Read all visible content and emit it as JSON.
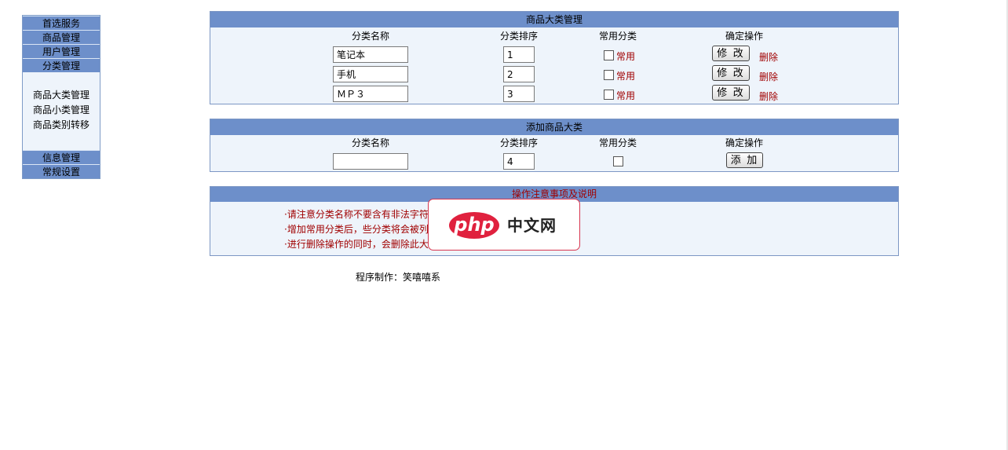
{
  "sidebar": {
    "items": [
      "首选服务",
      "商品管理",
      "用户管理",
      "分类管理"
    ],
    "sub_items": [
      "商品大类管理",
      "商品小类管理",
      "商品类别转移"
    ],
    "bottom_items": [
      "信息管理",
      "常规设置"
    ]
  },
  "manage": {
    "title": "商品大类管理",
    "headers": {
      "name": "分类名称",
      "order": "分类排序",
      "common": "常用分类",
      "action": "确定操作"
    },
    "rows": [
      {
        "name": "笔记本",
        "order": "1",
        "common_label": "常用",
        "modify": "修 改",
        "delete": "删除"
      },
      {
        "name": "手机",
        "order": "2",
        "common_label": "常用",
        "modify": "修 改",
        "delete": "删除"
      },
      {
        "name": "ＭＰ３",
        "order": "3",
        "common_label": "常用",
        "modify": "修 改",
        "delete": "删除"
      }
    ]
  },
  "add": {
    "title": "添加商品大类",
    "headers": {
      "name": "分类名称",
      "order": "分类排序",
      "common": "常用分类",
      "action": "确定操作"
    },
    "name_value": "",
    "order_value": "4",
    "add_label": "添 加"
  },
  "notes": {
    "title": "操作注意事项及说明",
    "lines": [
      "·请注意分类名称不要含有非法字符",
      "·增加常用分类后，些分类将会被列",
      "·进行删除操作的同时，会删除此大"
    ]
  },
  "footer": "程序制作：笑嘻嘻系",
  "watermark": {
    "logo": "php",
    "text": "中文网"
  }
}
